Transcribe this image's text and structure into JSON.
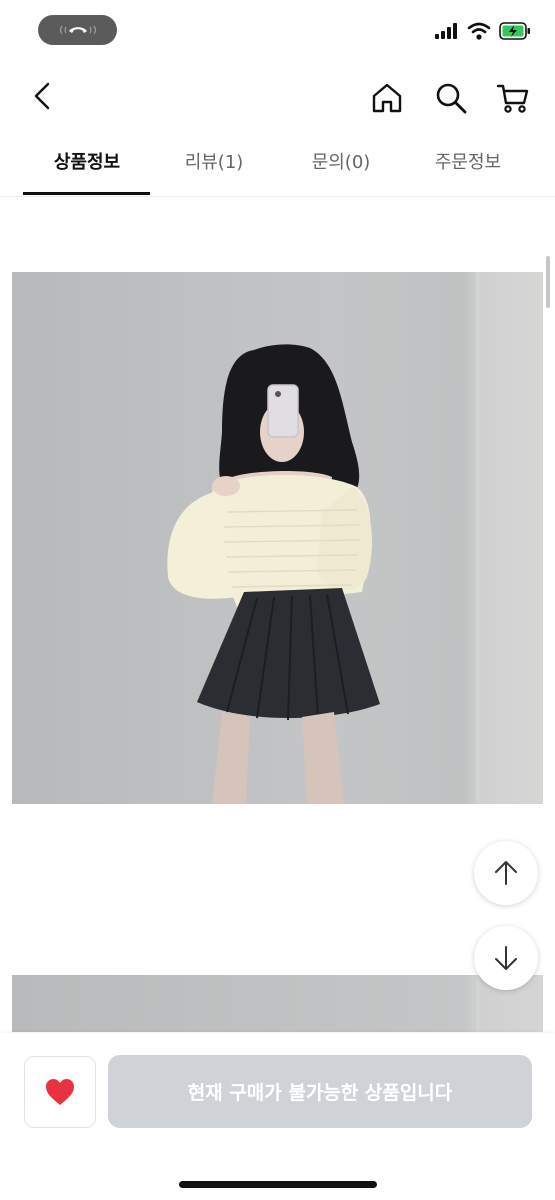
{
  "status_bar": {
    "call_icon": "phone-icon",
    "signal_icon": "signal-icon",
    "wifi_icon": "wifi-icon",
    "battery_icon": "battery-charging-icon"
  },
  "header": {
    "back_icon": "chevron-left-icon",
    "home_icon": "home-icon",
    "search_icon": "search-icon",
    "cart_icon": "cart-icon"
  },
  "tabs": [
    {
      "label": "상품정보",
      "active": true
    },
    {
      "label": "리뷰(1)",
      "active": false
    },
    {
      "label": "문의(0)",
      "active": false
    },
    {
      "label": "주문정보",
      "active": false
    }
  ],
  "scroll_buttons": {
    "up_icon": "arrow-up-icon",
    "down_icon": "arrow-down-icon"
  },
  "bottom_bar": {
    "heart_icon": "heart-icon",
    "heart_color": "#e8323f",
    "buy_label": "현재 구매가 불가능한 상품입니다",
    "buy_disabled": true
  },
  "colors": {
    "accent": "#111111",
    "disabled_button": "#cfd3d8"
  }
}
